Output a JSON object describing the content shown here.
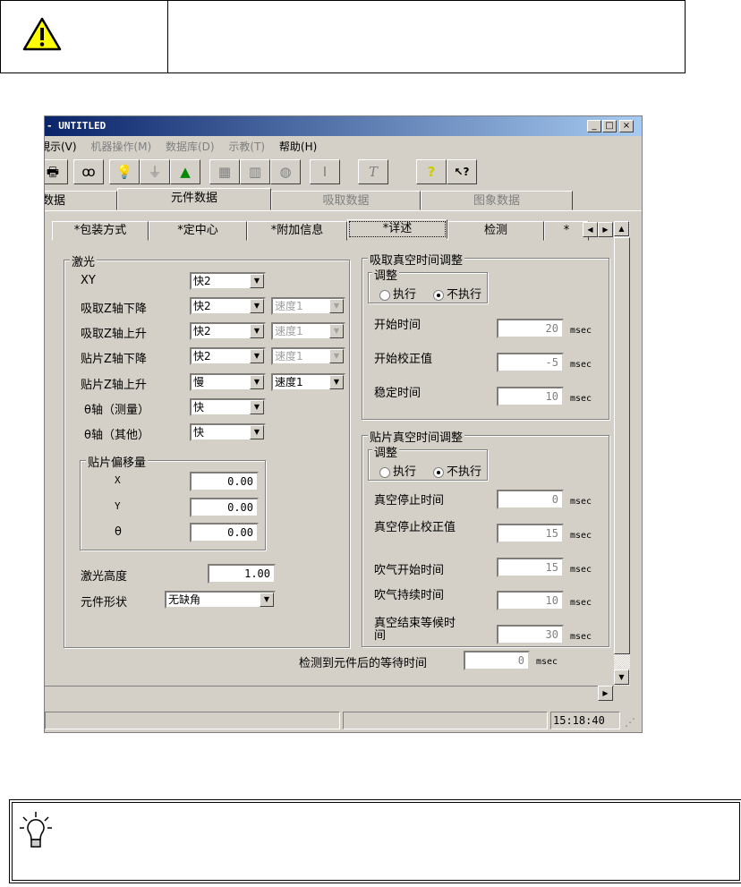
{
  "window": {
    "title": "- UNTITLED",
    "min": "_",
    "max": "□",
    "close": "×"
  },
  "menu": [
    {
      "label": "視示(V)"
    },
    {
      "label": "机器操作(M)"
    },
    {
      "label": "数据库(D)"
    },
    {
      "label": "示教(T)"
    },
    {
      "label": "帮助(H)"
    }
  ],
  "toolbar": [
    "print-icon",
    "binoculars-icon",
    "bulb-icon",
    "nozzle-icon",
    "shapes-icon",
    "grid-icon",
    "chip-icon",
    "package-icon",
    "stamp-icon",
    "text-icon",
    "help-icon",
    "context-help-icon"
  ],
  "toolbar_glyphs": [
    "🖶",
    "ꝏ",
    "💡",
    "⏚",
    "▲",
    "▦",
    "▥",
    "◍",
    "Ⅰ",
    "T",
    "?",
    "↖?"
  ],
  "main_tabs": [
    "数据",
    "元件数据",
    "吸取数据",
    "图象数据"
  ],
  "sub_tabs": [
    "*包装方式",
    "*定中心",
    "*附加信息",
    "*详述",
    "检测",
    "*"
  ],
  "laser": {
    "title": "激光",
    "rows": [
      {
        "label": "XY",
        "speed": "快2"
      },
      {
        "label": "吸取Z轴下降",
        "speed": "快2",
        "speed2": "速度1"
      },
      {
        "label": "吸取Z轴上升",
        "speed": "快2",
        "speed2": "速度1"
      },
      {
        "label": "贴片Z轴下降",
        "speed": "快2",
        "speed2": "速度1"
      },
      {
        "label": "贴片Z轴上升",
        "speed": "慢",
        "speed2": "速度1"
      },
      {
        "label": "θ轴（测量）",
        "speed": "快"
      },
      {
        "label": "θ轴（其他）",
        "speed": "快"
      }
    ],
    "offset": {
      "title": "贴片偏移量",
      "x_label": "X",
      "x": "0.00",
      "y_label": "Y",
      "y": "0.00",
      "t_label": "θ",
      "t": "0.00"
    },
    "height_label": "激光高度",
    "height": "1.00",
    "shape_label": "元件形状",
    "shape": "无缺角"
  },
  "pick_vac": {
    "title": "吸取真空时间调整",
    "adjust": "调整",
    "exec": "执行",
    "noexec": "不执行",
    "rows": [
      {
        "label": "开始时间",
        "value": "20"
      },
      {
        "label": "开始校正值",
        "value": "-5"
      },
      {
        "label": "稳定时间",
        "value": "10"
      }
    ]
  },
  "place_vac": {
    "title": "贴片真空时间调整",
    "adjust": "调整",
    "exec": "执行",
    "noexec": "不执行",
    "rows": [
      {
        "label": "真空停止时间",
        "value": "0"
      },
      {
        "label": "真空停止校正值",
        "value": "15"
      },
      {
        "label": "吹气开始时间",
        "value": "15"
      },
      {
        "label": "吹气持续时间",
        "value": "10"
      },
      {
        "label": "真空结束等候时间",
        "value": "30"
      }
    ]
  },
  "wait": {
    "label": "检测到元件后的等待时间",
    "value": "0"
  },
  "unit": "msec",
  "status": {
    "time": "15:18:40"
  },
  "colors": {
    "warning": "#ffff00",
    "title_start": "#0a246a",
    "title_end": "#a6caf0"
  }
}
